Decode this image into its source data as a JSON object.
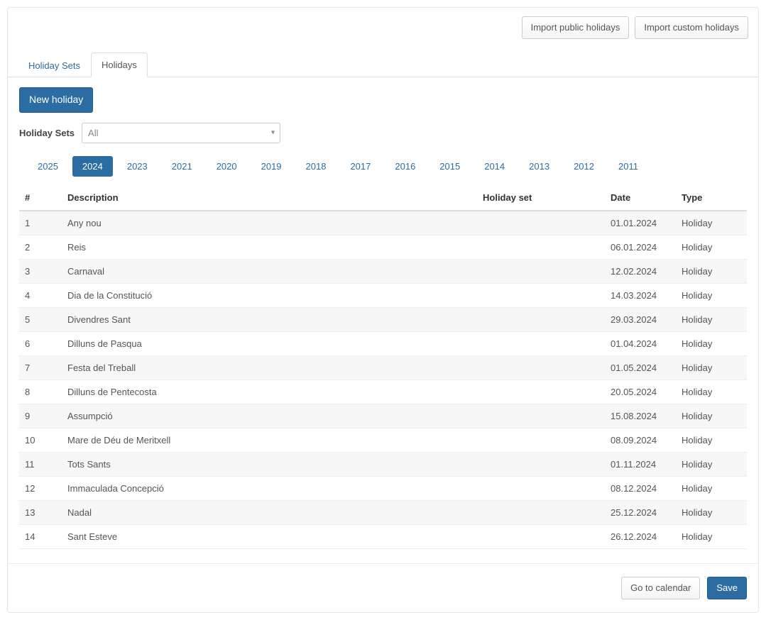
{
  "top_actions": {
    "import_public": "Import public holidays",
    "import_custom": "Import custom holidays"
  },
  "tabs": {
    "holiday_sets": "Holiday Sets",
    "holidays": "Holidays"
  },
  "new_holiday_label": "New holiday",
  "filter": {
    "label": "Holiday Sets",
    "selected": "All"
  },
  "years": [
    "2025",
    "2024",
    "2023",
    "2021",
    "2020",
    "2019",
    "2018",
    "2017",
    "2016",
    "2015",
    "2014",
    "2013",
    "2012",
    "2011"
  ],
  "active_year": "2024",
  "columns": {
    "num": "#",
    "description": "Description",
    "holiday_set": "Holiday set",
    "date": "Date",
    "type": "Type"
  },
  "rows": [
    {
      "n": "1",
      "desc": "Any nou",
      "set": "",
      "date": "01.01.2024",
      "type": "Holiday"
    },
    {
      "n": "2",
      "desc": "Reis",
      "set": "",
      "date": "06.01.2024",
      "type": "Holiday"
    },
    {
      "n": "3",
      "desc": "Carnaval",
      "set": "",
      "date": "12.02.2024",
      "type": "Holiday"
    },
    {
      "n": "4",
      "desc": "Dia de la Constitució",
      "set": "",
      "date": "14.03.2024",
      "type": "Holiday"
    },
    {
      "n": "5",
      "desc": "Divendres Sant",
      "set": "",
      "date": "29.03.2024",
      "type": "Holiday"
    },
    {
      "n": "6",
      "desc": "Dilluns de Pasqua",
      "set": "",
      "date": "01.04.2024",
      "type": "Holiday"
    },
    {
      "n": "7",
      "desc": "Festa del Treball",
      "set": "",
      "date": "01.05.2024",
      "type": "Holiday"
    },
    {
      "n": "8",
      "desc": "Dilluns de Pentecosta",
      "set": "",
      "date": "20.05.2024",
      "type": "Holiday"
    },
    {
      "n": "9",
      "desc": "Assumpció",
      "set": "",
      "date": "15.08.2024",
      "type": "Holiday"
    },
    {
      "n": "10",
      "desc": "Mare de Déu de Meritxell",
      "set": "",
      "date": "08.09.2024",
      "type": "Holiday"
    },
    {
      "n": "11",
      "desc": "Tots Sants",
      "set": "",
      "date": "01.11.2024",
      "type": "Holiday"
    },
    {
      "n": "12",
      "desc": "Immaculada Concepció",
      "set": "",
      "date": "08.12.2024",
      "type": "Holiday"
    },
    {
      "n": "13",
      "desc": "Nadal",
      "set": "",
      "date": "25.12.2024",
      "type": "Holiday"
    },
    {
      "n": "14",
      "desc": "Sant Esteve",
      "set": "",
      "date": "26.12.2024",
      "type": "Holiday"
    }
  ],
  "footer": {
    "go_calendar": "Go to calendar",
    "save": "Save"
  }
}
